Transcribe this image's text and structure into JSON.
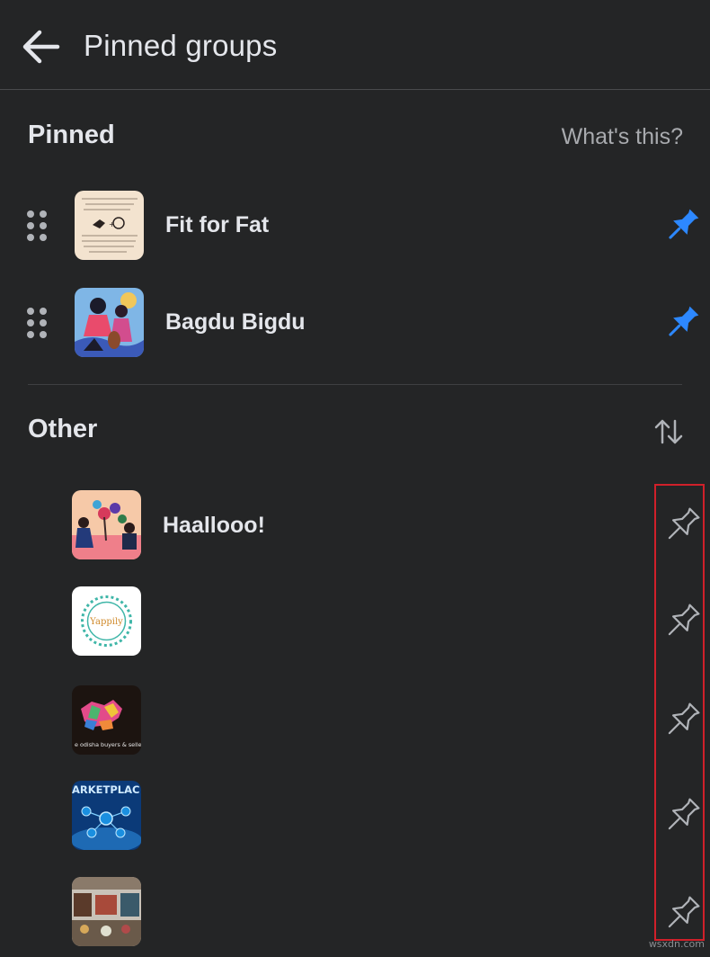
{
  "header": {
    "title": "Pinned groups",
    "back_icon": "arrow-left-icon"
  },
  "pinned": {
    "title": "Pinned",
    "help_link": "What's this?",
    "pin_color": "#2d88ff",
    "groups": [
      {
        "name": "Fit for Fat",
        "pinned": true
      },
      {
        "name": "Bagdu Bigdu",
        "pinned": true
      }
    ]
  },
  "other": {
    "title": "Other",
    "sort_icon": "sort-arrows-icon",
    "pin_color": "#b0b3b8",
    "groups": [
      {
        "name": "Haallooo!",
        "pinned": false
      },
      {
        "name": "",
        "thumb_text": "Yappily",
        "pinned": false
      },
      {
        "name": "",
        "thumb_text": "e odisha buyers & seller",
        "pinned": false
      },
      {
        "name": "",
        "thumb_text": "ARKETPLAC",
        "pinned": false
      },
      {
        "name": "",
        "pinned": false
      }
    ]
  },
  "watermark": "wsxdn.com"
}
